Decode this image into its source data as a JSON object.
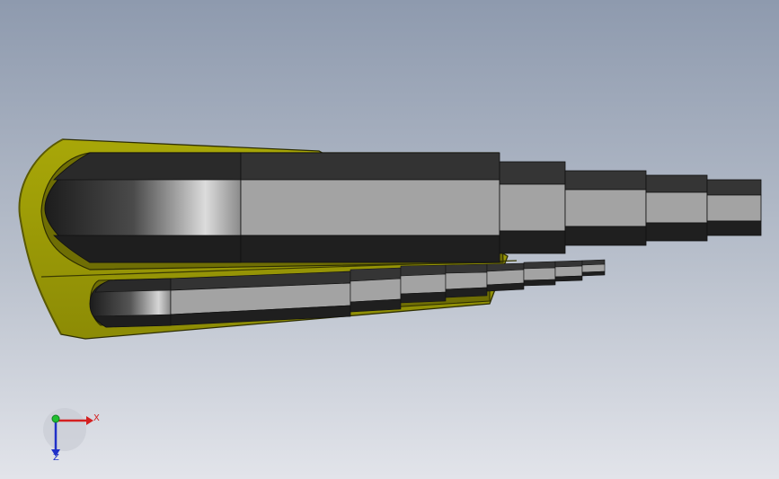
{
  "viewport": {
    "background_top": "#8e9aae",
    "background_bottom": "#e2e4ea"
  },
  "model": {
    "holder_color": "#9b9a06",
    "holder_dark": "#3a3a02",
    "bit_dark": "#262626",
    "bit_mid": "#3d3d3d",
    "bit_light": "#a2a2a2",
    "bit_highlight": "#d8d8d8"
  },
  "triad": {
    "x_label": "X",
    "z_label": "Z",
    "x_color": "#d42020",
    "y_color": "#20c030",
    "z_color": "#2030c8"
  }
}
